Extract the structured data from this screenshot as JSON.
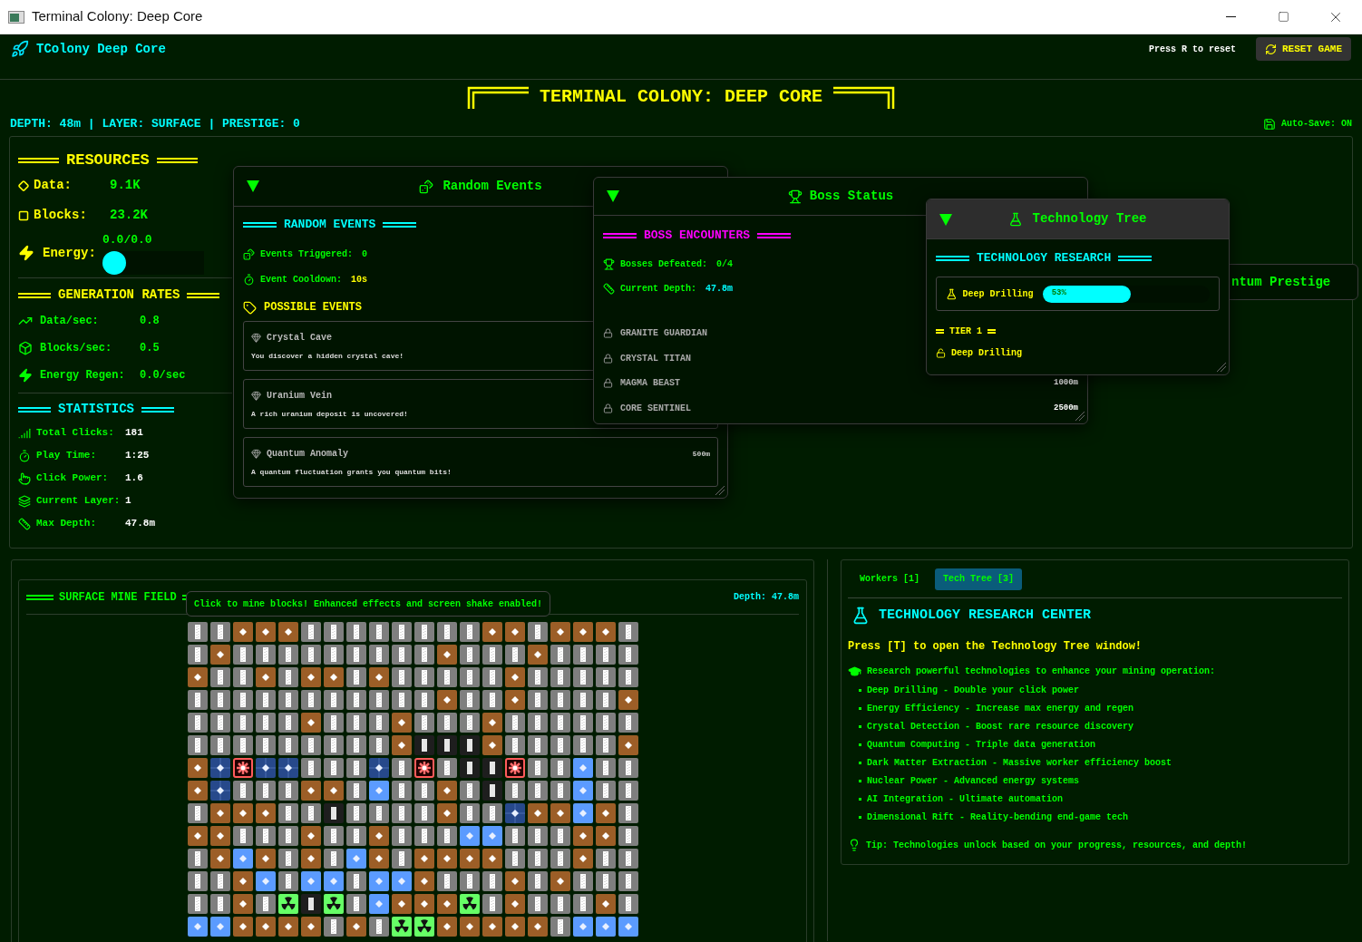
{
  "window": {
    "title": "Terminal Colony: Deep Core"
  },
  "header": {
    "brand": "TColony Deep Core",
    "hint": "Press R to reset",
    "reset_button": "RESET GAME"
  },
  "banner": {
    "title": "TERMINAL COLONY: DEEP CORE"
  },
  "status_line": "DEPTH: 48m | LAYER: SURFACE | PRESTIGE: 0",
  "auto_save": "Auto-Save: ON",
  "resources": {
    "title": "RESOURCES",
    "items": [
      {
        "label": "Data:",
        "value": "9.1K"
      },
      {
        "label": "Blocks:",
        "value": "23.2K"
      }
    ],
    "energy": {
      "label": "Energy:",
      "reading": "0.0/0.0",
      "level": 0
    }
  },
  "generation": {
    "title": "GENERATION RATES",
    "items": [
      {
        "label": "Data/sec:",
        "value": "0.8"
      },
      {
        "label": "Blocks/sec:",
        "value": "0.5"
      },
      {
        "label": "Energy Regen:",
        "value": "0.0/sec"
      }
    ]
  },
  "statistics": {
    "title": "STATISTICS",
    "items": [
      {
        "label": "Total Clicks:",
        "value": "181"
      },
      {
        "label": "Play Time:",
        "value": "1:25"
      },
      {
        "label": "Click Power:",
        "value": "1.6"
      },
      {
        "label": "Current Layer:",
        "value": "1"
      },
      {
        "label": "Max Depth:",
        "value": "47.8m"
      }
    ]
  },
  "random_events": {
    "title": "Random Events",
    "heading": "RANDOM EVENTS",
    "stats": [
      {
        "label": "Events Triggered:",
        "value": "0"
      },
      {
        "label": "Event Cooldown:",
        "value": "10s"
      }
    ],
    "list_title": "POSSIBLE EVENTS",
    "events": [
      {
        "name": "Crystal Cave",
        "description": "You discover a hidden crystal cave!"
      },
      {
        "name": "Uranium Vein",
        "description": "A rich uranium deposit is uncovered!"
      },
      {
        "name": "Quantum Anomaly",
        "description": "A quantum fluctuation grants you quantum bits!",
        "depth": "500m"
      }
    ]
  },
  "boss_status": {
    "title": "Boss Status",
    "heading": "BOSS ENCOUNTERS",
    "stats": [
      {
        "label": "Bosses Defeated:",
        "value": "0/4"
      },
      {
        "label": "Current Depth:",
        "value": "47.8m"
      }
    ],
    "bosses": [
      {
        "name": "GRANITE GUARDIAN"
      },
      {
        "name": "CRYSTAL TITAN"
      },
      {
        "name": "MAGMA BEAST",
        "depth": "1000m"
      },
      {
        "name": "CORE SENTINEL",
        "depth": "2500m"
      }
    ]
  },
  "tech_tree": {
    "title": "Technology Tree",
    "heading": "TECHNOLOGY RESEARCH",
    "research": {
      "name": "Deep Drilling",
      "level": 0.53,
      "reading": "53%"
    },
    "tier": "TIER 1",
    "unlocked": [
      "Deep Drilling"
    ]
  },
  "prestige_window": {
    "title": "ntum Prestige"
  },
  "mine_field": {
    "title": "SURFACE MINE FIELD",
    "tooltip": "Click to mine blocks! Enhanced effects and screen shake enabled!",
    "depth": "Depth: 47.8m",
    "rows": [
      {
        "blocks": [
          {
            "kind": "stone"
          },
          {
            "kind": "stone"
          },
          {
            "kind": "dirt"
          },
          {
            "kind": "dirt"
          },
          {
            "kind": "dirt"
          },
          {
            "kind": "stone"
          },
          {
            "kind": "stone"
          },
          {
            "kind": "stone"
          },
          {
            "kind": "stone"
          },
          {
            "kind": "stone"
          },
          {
            "kind": "stone"
          },
          {
            "kind": "stone"
          },
          {
            "kind": "stone"
          },
          {
            "kind": "dirt"
          },
          {
            "kind": "dirt"
          },
          {
            "kind": "stone"
          },
          {
            "kind": "dirt"
          },
          {
            "kind": "dirt"
          },
          {
            "kind": "dirt"
          },
          {
            "kind": "stone"
          }
        ]
      },
      {
        "blocks": [
          {
            "kind": "stone"
          },
          {
            "kind": "dirt"
          },
          {
            "kind": "stone"
          },
          {
            "kind": "stone"
          },
          {
            "kind": "stone"
          },
          {
            "kind": "stone"
          },
          {
            "kind": "stone"
          },
          {
            "kind": "stone"
          },
          {
            "kind": "stone"
          },
          {
            "kind": "stone"
          },
          {
            "kind": "stone"
          },
          {
            "kind": "dirt"
          },
          {
            "kind": "stone"
          },
          {
            "kind": "stone"
          },
          {
            "kind": "stone"
          },
          {
            "kind": "dirt"
          },
          {
            "kind": "stone"
          },
          {
            "kind": "stone"
          },
          {
            "kind": "stone"
          },
          {
            "kind": "stone"
          }
        ]
      },
      {
        "blocks": [
          {
            "kind": "dirt"
          },
          {
            "kind": "stone"
          },
          {
            "kind": "stone"
          },
          {
            "kind": "dirt"
          },
          {
            "kind": "stone"
          },
          {
            "kind": "dirt"
          },
          {
            "kind": "dirt"
          },
          {
            "kind": "stone"
          },
          {
            "kind": "dirt"
          },
          {
            "kind": "stone"
          },
          {
            "kind": "stone"
          },
          {
            "kind": "stone"
          },
          {
            "kind": "stone"
          },
          {
            "kind": "stone"
          },
          {
            "kind": "dirt"
          },
          {
            "kind": "stone"
          },
          {
            "kind": "stone"
          },
          {
            "kind": "stone"
          },
          {
            "kind": "stone"
          },
          {
            "kind": "stone"
          }
        ]
      },
      {
        "blocks": [
          {
            "kind": "stone"
          },
          {
            "kind": "stone"
          },
          {
            "kind": "stone"
          },
          {
            "kind": "stone"
          },
          {
            "kind": "stone"
          },
          {
            "kind": "stone"
          },
          {
            "kind": "stone"
          },
          {
            "kind": "stone"
          },
          {
            "kind": "stone"
          },
          {
            "kind": "stone"
          },
          {
            "kind": "stone"
          },
          {
            "kind": "dirt"
          },
          {
            "kind": "stone"
          },
          {
            "kind": "stone"
          },
          {
            "kind": "dirt"
          },
          {
            "kind": "stone"
          },
          {
            "kind": "stone"
          },
          {
            "kind": "stone"
          },
          {
            "kind": "stone"
          },
          {
            "kind": "dirt"
          }
        ]
      },
      {
        "blocks": [
          {
            "kind": "stone"
          },
          {
            "kind": "stone"
          },
          {
            "kind": "stone"
          },
          {
            "kind": "stone"
          },
          {
            "kind": "stone"
          },
          {
            "kind": "dirt"
          },
          {
            "kind": "stone"
          },
          {
            "kind": "stone"
          },
          {
            "kind": "stone"
          },
          {
            "kind": "dirt"
          },
          {
            "kind": "stone"
          },
          {
            "kind": "stone"
          },
          {
            "kind": "stone"
          },
          {
            "kind": "dirt"
          },
          {
            "kind": "stone"
          },
          {
            "kind": "stone"
          },
          {
            "kind": "stone"
          },
          {
            "kind": "stone"
          },
          {
            "kind": "stone"
          },
          {
            "kind": "stone"
          }
        ]
      },
      {
        "blocks": [
          {
            "kind": "stone"
          },
          {
            "kind": "stone"
          },
          {
            "kind": "stone"
          },
          {
            "kind": "stone"
          },
          {
            "kind": "stone"
          },
          {
            "kind": "stone"
          },
          {
            "kind": "stone"
          },
          {
            "kind": "stone"
          },
          {
            "kind": "stone"
          },
          {
            "kind": "dirt"
          },
          {
            "kind": "void"
          },
          {
            "kind": "void"
          },
          {
            "kind": "void"
          },
          {
            "kind": "dirt"
          },
          {
            "kind": "stone"
          },
          {
            "kind": "stone"
          },
          {
            "kind": "stone"
          },
          {
            "kind": "stone"
          },
          {
            "kind": "stone"
          },
          {
            "kind": "dirt"
          }
        ]
      },
      {
        "blocks": [
          {
            "kind": "dirt"
          },
          {
            "kind": "cobalt"
          },
          {
            "kind": "boss"
          },
          {
            "kind": "cobalt"
          },
          {
            "kind": "cobalt"
          },
          {
            "kind": "stone"
          },
          {
            "kind": "stone"
          },
          {
            "kind": "stone"
          },
          {
            "kind": "cobalt"
          },
          {
            "kind": "stone"
          },
          {
            "kind": "boss"
          },
          {
            "kind": "stone"
          },
          {
            "kind": "void"
          },
          {
            "kind": "void"
          },
          {
            "kind": "boss"
          },
          {
            "kind": "stone"
          },
          {
            "kind": "stone"
          },
          {
            "kind": "ice"
          },
          {
            "kind": "stone"
          },
          {
            "kind": "stone"
          }
        ]
      },
      {
        "blocks": [
          {
            "kind": "dirt"
          },
          {
            "kind": "cobalt"
          },
          {
            "kind": "stone"
          },
          {
            "kind": "stone"
          },
          {
            "kind": "stone"
          },
          {
            "kind": "dirt"
          },
          {
            "kind": "dirt"
          },
          {
            "kind": "stone"
          },
          {
            "kind": "ice"
          },
          {
            "kind": "stone"
          },
          {
            "kind": "stone"
          },
          {
            "kind": "dirt"
          },
          {
            "kind": "stone"
          },
          {
            "kind": "void"
          },
          {
            "kind": "stone"
          },
          {
            "kind": "stone"
          },
          {
            "kind": "stone"
          },
          {
            "kind": "ice"
          },
          {
            "kind": "stone"
          },
          {
            "kind": "stone"
          }
        ]
      },
      {
        "blocks": [
          {
            "kind": "stone"
          },
          {
            "kind": "dirt"
          },
          {
            "kind": "dirt"
          },
          {
            "kind": "dirt"
          },
          {
            "kind": "stone"
          },
          {
            "kind": "stone"
          },
          {
            "kind": "void"
          },
          {
            "kind": "stone"
          },
          {
            "kind": "stone"
          },
          {
            "kind": "stone"
          },
          {
            "kind": "stone"
          },
          {
            "kind": "dirt"
          },
          {
            "kind": "stone"
          },
          {
            "kind": "stone"
          },
          {
            "kind": "cobalt"
          },
          {
            "kind": "dirt"
          },
          {
            "kind": "dirt"
          },
          {
            "kind": "ice"
          },
          {
            "kind": "dirt"
          },
          {
            "kind": "stone"
          }
        ]
      },
      {
        "blocks": [
          {
            "kind": "dirt"
          },
          {
            "kind": "dirt"
          },
          {
            "kind": "stone"
          },
          {
            "kind": "stone"
          },
          {
            "kind": "stone"
          },
          {
            "kind": "dirt"
          },
          {
            "kind": "stone"
          },
          {
            "kind": "stone"
          },
          {
            "kind": "dirt"
          },
          {
            "kind": "stone"
          },
          {
            "kind": "stone"
          },
          {
            "kind": "stone"
          },
          {
            "kind": "ice"
          },
          {
            "kind": "ice"
          },
          {
            "kind": "stone"
          },
          {
            "kind": "stone"
          },
          {
            "kind": "stone"
          },
          {
            "kind": "dirt"
          },
          {
            "kind": "dirt"
          },
          {
            "kind": "stone"
          }
        ]
      },
      {
        "blocks": [
          {
            "kind": "stone"
          },
          {
            "kind": "dirt"
          },
          {
            "kind": "ice"
          },
          {
            "kind": "dirt"
          },
          {
            "kind": "stone"
          },
          {
            "kind": "dirt"
          },
          {
            "kind": "stone"
          },
          {
            "kind": "ice"
          },
          {
            "kind": "dirt"
          },
          {
            "kind": "stone"
          },
          {
            "kind": "dirt"
          },
          {
            "kind": "dirt"
          },
          {
            "kind": "dirt"
          },
          {
            "kind": "dirt"
          },
          {
            "kind": "stone"
          },
          {
            "kind": "stone"
          },
          {
            "kind": "stone"
          },
          {
            "kind": "dirt"
          },
          {
            "kind": "stone"
          },
          {
            "kind": "stone"
          }
        ]
      },
      {
        "blocks": [
          {
            "kind": "stone"
          },
          {
            "kind": "stone"
          },
          {
            "kind": "dirt"
          },
          {
            "kind": "ice"
          },
          {
            "kind": "stone"
          },
          {
            "kind": "ice"
          },
          {
            "kind": "ice"
          },
          {
            "kind": "stone"
          },
          {
            "kind": "ice"
          },
          {
            "kind": "ice"
          },
          {
            "kind": "dirt"
          },
          {
            "kind": "stone"
          },
          {
            "kind": "stone"
          },
          {
            "kind": "stone"
          },
          {
            "kind": "dirt"
          },
          {
            "kind": "stone"
          },
          {
            "kind": "dirt"
          },
          {
            "kind": "stone"
          },
          {
            "kind": "stone"
          },
          {
            "kind": "stone"
          }
        ]
      },
      {
        "blocks": [
          {
            "kind": "stone"
          },
          {
            "kind": "stone"
          },
          {
            "kind": "dirt"
          },
          {
            "kind": "stone"
          },
          {
            "kind": "rad"
          },
          {
            "kind": "void"
          },
          {
            "kind": "rad"
          },
          {
            "kind": "stone"
          },
          {
            "kind": "ice"
          },
          {
            "kind": "dirt"
          },
          {
            "kind": "dirt"
          },
          {
            "kind": "dirt"
          },
          {
            "kind": "rad"
          },
          {
            "kind": "stone"
          },
          {
            "kind": "dirt"
          },
          {
            "kind": "stone"
          },
          {
            "kind": "stone"
          },
          {
            "kind": "stone"
          },
          {
            "kind": "dirt"
          },
          {
            "kind": "stone"
          }
        ]
      },
      {
        "blocks": [
          {
            "kind": "ice"
          },
          {
            "kind": "ice"
          },
          {
            "kind": "dirt"
          },
          {
            "kind": "dirt"
          },
          {
            "kind": "dirt"
          },
          {
            "kind": "dirt"
          },
          {
            "kind": "stone"
          },
          {
            "kind": "dirt"
          },
          {
            "kind": "stone"
          },
          {
            "kind": "rad"
          },
          {
            "kind": "rad"
          },
          {
            "kind": "dirt"
          },
          {
            "kind": "dirt"
          },
          {
            "kind": "dirt"
          },
          {
            "kind": "dirt"
          },
          {
            "kind": "dirt"
          },
          {
            "kind": "stone"
          },
          {
            "kind": "ice"
          },
          {
            "kind": "ice"
          },
          {
            "kind": "ice"
          }
        ]
      }
    ]
  },
  "side_panel": {
    "tabs": [
      {
        "label": "Workers [1]",
        "selected": false
      },
      {
        "label": "Tech Tree [3]",
        "selected": true
      }
    ],
    "heading": "TECHNOLOGY RESEARCH CENTER",
    "prompt": "Press [T] to open the Technology Tree window!",
    "intro": "Research powerful technologies to enhance your mining operation:",
    "techs": [
      "Deep Drilling - Double your click power",
      "Energy Efficiency - Increase max energy and regen",
      "Crystal Detection - Boost rare resource discovery",
      "Quantum Computing - Triple data generation",
      "Dark Matter Extraction - Massive worker efficiency boost",
      "Nuclear Power - Advanced energy systems",
      "AI Integration - Ultimate automation",
      "Dimensional Rift - Reality-bending end-game tech"
    ],
    "tip": "Tip: Technologies unlock based on your progress, resources, and depth!"
  }
}
